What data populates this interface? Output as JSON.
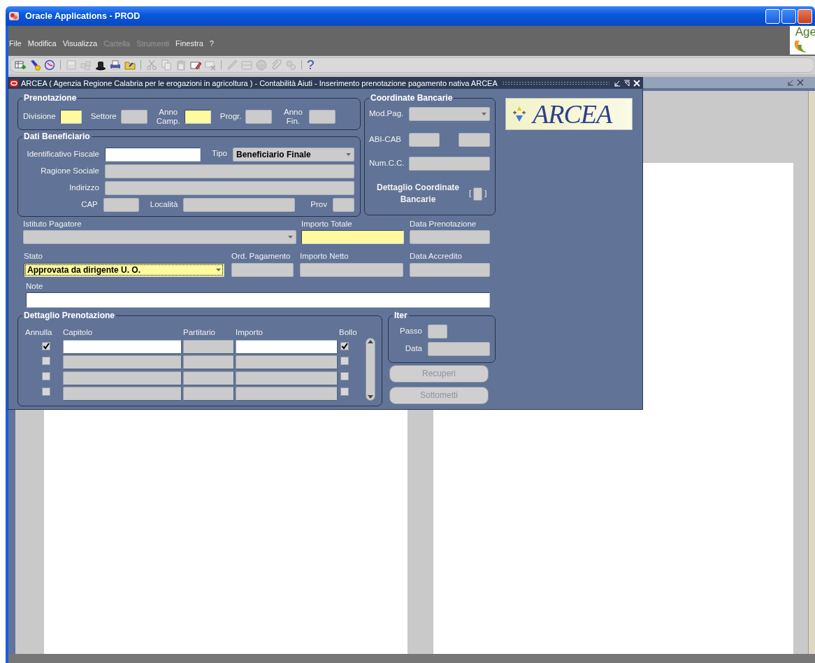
{
  "window": {
    "title": "Oracle Applications - PROD"
  },
  "menu": [
    {
      "label": "File",
      "disabled": false
    },
    {
      "label": "Modifica",
      "disabled": false
    },
    {
      "label": "Visualizza",
      "disabled": false
    },
    {
      "label": "Cartella",
      "disabled": true
    },
    {
      "label": "Strumenti",
      "disabled": true
    },
    {
      "label": "Finestra",
      "disabled": false
    },
    {
      "label": "?",
      "disabled": false
    }
  ],
  "agency_logo": {
    "text": "Age"
  },
  "toolbar": [
    {
      "kind": "new-record",
      "disabled": false
    },
    {
      "kind": "find",
      "disabled": false
    },
    {
      "kind": "navigator",
      "disabled": false
    },
    {
      "kind": "separator"
    },
    {
      "kind": "save",
      "disabled": true
    },
    {
      "kind": "next-step",
      "disabled": true
    },
    {
      "kind": "switch",
      "disabled": false
    },
    {
      "kind": "print",
      "disabled": false
    },
    {
      "kind": "folder",
      "disabled": false
    },
    {
      "kind": "separator"
    },
    {
      "kind": "cut",
      "disabled": true
    },
    {
      "kind": "copy",
      "disabled": true
    },
    {
      "kind": "paste",
      "disabled": true
    },
    {
      "kind": "clear",
      "disabled": false
    },
    {
      "kind": "delete",
      "disabled": true
    },
    {
      "kind": "separator"
    },
    {
      "kind": "edit",
      "disabled": true
    },
    {
      "kind": "cabinet",
      "disabled": true
    },
    {
      "kind": "globe",
      "disabled": true
    },
    {
      "kind": "attach",
      "disabled": true
    },
    {
      "kind": "tools",
      "disabled": true
    },
    {
      "kind": "separator"
    },
    {
      "kind": "help",
      "label": "?",
      "disabled": false
    }
  ],
  "form": {
    "title": "ARCEA  ( Agenzia Regione Calabria per  le  erogazioni  in  agricoltura ) - Contabilità  Aiuti - Inserimento prenotazione pagamento nativa ARCEA",
    "prenotazione": {
      "title": "Prenotazione",
      "fields": [
        {
          "label": "Divisione",
          "required": true,
          "read_only": false
        },
        {
          "label": "Settore",
          "required": false,
          "read_only": true
        },
        {
          "label": "Anno Camp.",
          "required": true,
          "read_only": false
        },
        {
          "label": "Progr.",
          "required": false,
          "read_only": true
        },
        {
          "label": "Anno Fin.",
          "required": false,
          "read_only": true
        }
      ]
    },
    "beneficiario": {
      "title": "Dati Beneficiario",
      "identificativo": {
        "label": "Identificativo Fiscale",
        "required": false,
        "read_only": false
      },
      "tipo": {
        "label": "Tipo",
        "value": "Beneficiario Finale",
        "required": false,
        "read_only": true
      },
      "ragione_sociale": {
        "label": "Ragione Sociale",
        "required": false,
        "read_only": true
      },
      "indirizzo": {
        "label": "Indirizzo",
        "required": false,
        "read_only": true
      },
      "cap": {
        "label": "CAP",
        "required": false,
        "read_only": true
      },
      "localita": {
        "label": "Località",
        "required": false,
        "read_only": true
      },
      "prov": {
        "label": "Prov",
        "required": false,
        "read_only": true
      }
    },
    "coordinate": {
      "title": "Coordinate Bancarie",
      "mod_pag": {
        "label": "Mod.Pag.",
        "required": false,
        "read_only": true
      },
      "abi_cab": {
        "label": "ABI-CAB",
        "required": false,
        "read_only": true
      },
      "num_cc": {
        "label": "Num.C.C.",
        "required": false,
        "read_only": true
      },
      "dettaglio": {
        "label": "Dettaglio Coordinate Bancarie",
        "bracket_open": "[",
        "bracket_close": "]",
        "checked": false
      }
    },
    "logo": {
      "text": "ARCEA"
    },
    "istituto_pagatore": {
      "label": "Istituto Pagatore",
      "required": false,
      "read_only": true
    },
    "importo_totale": {
      "label": "Importo Totale",
      "required": true,
      "read_only": false
    },
    "data_prenotazione": {
      "label": "Data Prenotazione",
      "required": false,
      "read_only": true
    },
    "stato": {
      "label": "Stato",
      "value": "Approvata da dirigente U. O.",
      "required": true,
      "read_only": false
    },
    "ord_pagamento": {
      "label": "Ord. Pagamento",
      "required": false,
      "read_only": true
    },
    "importo_netto": {
      "label": "Importo Netto",
      "required": false,
      "read_only": true
    },
    "data_accredito": {
      "label": "Data Accredito",
      "required": false,
      "read_only": true
    },
    "note": {
      "label": "Note",
      "required": false,
      "read_only": false
    },
    "dettaglio": {
      "title": "Dettaglio Prenotazione",
      "columns": [
        "Annulla",
        "Capitolo",
        "Partitario",
        "Importo",
        "Bollo"
      ],
      "rows": [
        {
          "annulla": true,
          "bollo": true,
          "selected": true
        },
        {
          "annulla": false,
          "bollo": false,
          "selected": false
        },
        {
          "annulla": false,
          "bollo": false,
          "selected": false
        },
        {
          "annulla": false,
          "bollo": false,
          "selected": false
        }
      ]
    },
    "iter": {
      "title": "Iter",
      "passo": {
        "label": "Passo",
        "required": false,
        "read_only": true
      },
      "data": {
        "label": "Data",
        "required": false,
        "read_only": true
      }
    },
    "buttons": [
      {
        "label": "Recuperi",
        "disabled": true
      },
      {
        "label": "Sottometti",
        "disabled": true
      }
    ]
  }
}
